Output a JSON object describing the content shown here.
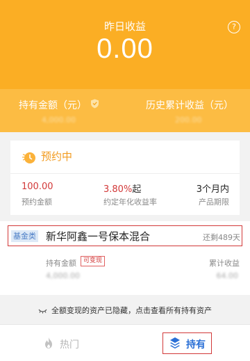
{
  "header": {
    "yesterday_label": "昨日收益",
    "yesterday_value": "0.00",
    "help_icon": "question-circle-icon"
  },
  "summary": {
    "holding_label": "持有金额（元）",
    "history_label": "历史累计收益（元）",
    "holding_value": "4,000.00",
    "history_value": "200.00"
  },
  "reservation": {
    "title": "预约中",
    "amount": "100.00",
    "amount_label": "预约金额",
    "rate": "3.80%",
    "rate_suffix": "起",
    "rate_label": "约定年化收益率",
    "term": "3个月内",
    "term_label": "产品期限"
  },
  "fund": {
    "tag": "基金类",
    "name": "新华阿鑫一号保本混合",
    "days_left": "还剩489天",
    "holding_label": "持有金额",
    "redeem_badge": "可变现",
    "cumulative_label": "累计收益",
    "holding_value": "4,000.00",
    "cumulative_value": "64.00"
  },
  "notice": {
    "text": "全额变现的资产已隐藏，点击查看所有持有资产"
  },
  "tabs": [
    {
      "label": "热门",
      "icon": "flame-icon"
    },
    {
      "label": "持有",
      "icon": "layers-icon"
    }
  ],
  "colors": {
    "brand": "#fbae24",
    "band": "#fcbc43",
    "accent_red": "#d23838",
    "active_tab": "#2a6fd6",
    "inactive_tab": "#b7b7b7"
  }
}
